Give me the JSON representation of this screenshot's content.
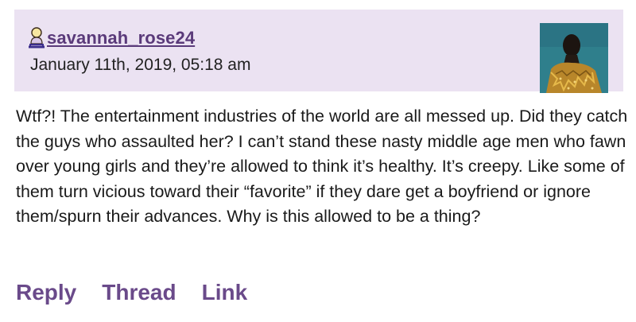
{
  "comment": {
    "username": "savannah_rose24",
    "timestamp": "January 11th, 2019, 05:18 am",
    "body": "Wtf?! The entertainment industries of the world are all messed up. Did they catch the guys who assaulted her? I can’t stand these nasty middle age men who fawn over young girls and they’re allowed to think it’s healthy. It’s creepy. Like some of them turn vicious toward their “favorite” if they dare get a boyfriend or ignore them/spurn their advances. Why is this allowed to be a thing?",
    "user_icon": "user-profile-icon",
    "avatar": "user-avatar-image"
  },
  "actions": {
    "reply_label": "Reply",
    "thread_label": "Thread",
    "link_label": "Link"
  },
  "colors": {
    "header_background": "#ebe2f2",
    "link_color": "#6a4a8a",
    "username_color": "#5a3a7a"
  }
}
